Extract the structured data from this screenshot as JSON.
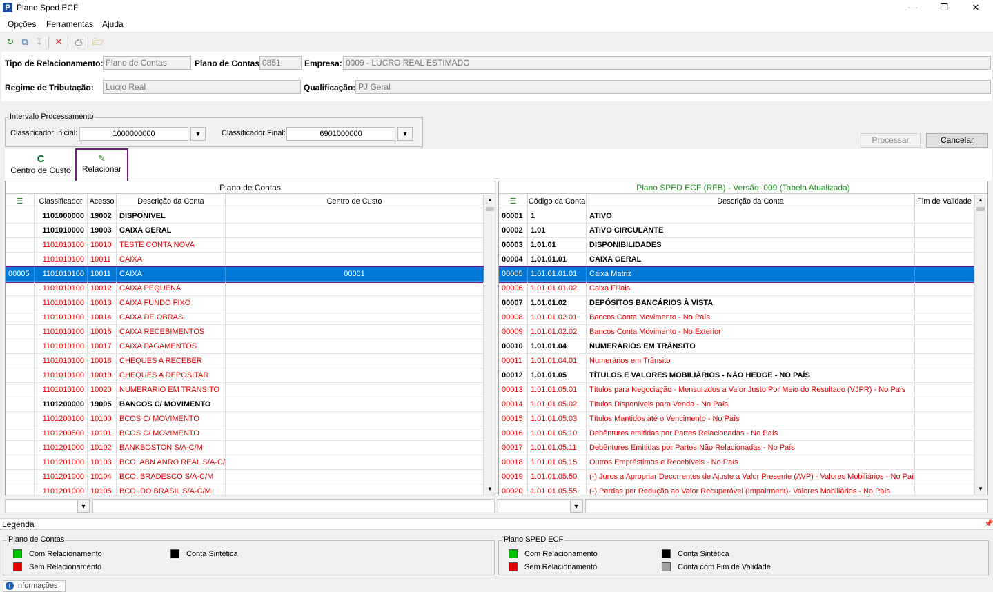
{
  "window": {
    "title": "Plano Sped ECF",
    "app_icon": "P"
  },
  "menu": [
    "Opções",
    "Ferramentas",
    "Ajuda"
  ],
  "form": {
    "tipo_label": "Tipo de Relacionamento:",
    "tipo_value": "Plano de Contas",
    "plano_label": "Plano de Contas:",
    "plano_value": "0851",
    "empresa_label": "Empresa:",
    "empresa_value": "0009 - LUCRO REAL ESTIMADO",
    "regime_label": "Regime de Tributação:",
    "regime_value": "Lucro Real",
    "qualificacao_label": "Qualificação:",
    "qualificacao_value": "PJ Geral"
  },
  "intervalo": {
    "title": "Intervalo Processamento",
    "inicial_label": "Classificador Inicial:",
    "inicial_value": "1000000000",
    "final_label": "Classificador Final:",
    "final_value": "6901000000"
  },
  "buttons": {
    "processar": "Processar",
    "cancelar": "Cancelar",
    "centro_glyph": "C",
    "centro": "Centro de Custo",
    "relacionar": "Relacionar"
  },
  "left_grid": {
    "title": "Plano de Contas",
    "headers": [
      "",
      "Classificador",
      "Acesso",
      "Descrição da Conta",
      "Centro de Custo"
    ],
    "rows": [
      {
        "n": "",
        "cls": "1101000000",
        "ac": "19002",
        "desc": "DISPONIVEL",
        "cc": "",
        "type": "sint"
      },
      {
        "n": "",
        "cls": "1101010000",
        "ac": "19003",
        "desc": "CAIXA GERAL",
        "cc": "",
        "type": "sint"
      },
      {
        "n": "",
        "cls": "1101010100",
        "ac": "10010",
        "desc": "TESTE CONTA NOVA",
        "cc": "",
        "type": "norel"
      },
      {
        "n": "",
        "cls": "1101010100",
        "ac": "10011",
        "desc": "CAIXA",
        "cc": "",
        "type": "norel"
      },
      {
        "n": "00005",
        "cls": "1101010100",
        "ac": "10011",
        "desc": "CAIXA",
        "cc": "00001",
        "type": "sel"
      },
      {
        "n": "",
        "cls": "1101010100",
        "ac": "10012",
        "desc": "CAIXA PEQUENA",
        "cc": "",
        "type": "norel"
      },
      {
        "n": "",
        "cls": "1101010100",
        "ac": "10013",
        "desc": "CAIXA FUNDO FIXO",
        "cc": "",
        "type": "norel"
      },
      {
        "n": "",
        "cls": "1101010100",
        "ac": "10014",
        "desc": "CAIXA DE OBRAS",
        "cc": "",
        "type": "norel"
      },
      {
        "n": "",
        "cls": "1101010100",
        "ac": "10016",
        "desc": "CAIXA RECEBIMENTOS",
        "cc": "",
        "type": "norel"
      },
      {
        "n": "",
        "cls": "1101010100",
        "ac": "10017",
        "desc": "CAIXA PAGAMENTOS",
        "cc": "",
        "type": "norel"
      },
      {
        "n": "",
        "cls": "1101010100",
        "ac": "10018",
        "desc": "CHEQUES A RECEBER",
        "cc": "",
        "type": "norel"
      },
      {
        "n": "",
        "cls": "1101010100",
        "ac": "10019",
        "desc": "CHEQUES A DEPOSITAR",
        "cc": "",
        "type": "norel"
      },
      {
        "n": "",
        "cls": "1101010100",
        "ac": "10020",
        "desc": "NUMERARIO EM TRANSITO",
        "cc": "",
        "type": "norel"
      },
      {
        "n": "",
        "cls": "1101200000",
        "ac": "19005",
        "desc": "BANCOS C/ MOVIMENTO",
        "cc": "",
        "type": "sint"
      },
      {
        "n": "",
        "cls": "1101200100",
        "ac": "10100",
        "desc": "BCOS C/ MOVIMENTO",
        "cc": "",
        "type": "norel"
      },
      {
        "n": "",
        "cls": "1101200500",
        "ac": "10101",
        "desc": "BCOS C/ MOVIMENTO",
        "cc": "",
        "type": "norel"
      },
      {
        "n": "",
        "cls": "1101201000",
        "ac": "10102",
        "desc": "BANKBOSTON S/A-C/M",
        "cc": "",
        "type": "norel"
      },
      {
        "n": "",
        "cls": "1101201000",
        "ac": "10103",
        "desc": "BCO. ABN ANRO REAL S/A-C/M",
        "cc": "",
        "type": "norel"
      },
      {
        "n": "",
        "cls": "1101201000",
        "ac": "10104",
        "desc": "BCO. BRADESCO S/A-C/M",
        "cc": "",
        "type": "norel"
      },
      {
        "n": "",
        "cls": "1101201000",
        "ac": "10105",
        "desc": "BCO. DO BRASIL S/A-C/M",
        "cc": "",
        "type": "norel"
      }
    ]
  },
  "right_grid": {
    "title": "Plano SPED ECF (RFB) - Versão: 009 (Tabela Atualizada)",
    "title_color": "#109010",
    "headers": [
      "",
      "Código da Conta",
      "Descrição da Conta",
      "Fim de Validade"
    ],
    "rows": [
      {
        "n": "00001",
        "code": "1",
        "desc": "ATIVO",
        "fim": "",
        "type": "sint"
      },
      {
        "n": "00002",
        "code": "1.01",
        "desc": "ATIVO CIRCULANTE",
        "fim": "",
        "type": "sint"
      },
      {
        "n": "00003",
        "code": "1.01.01",
        "desc": "DISPONIBILIDADES",
        "fim": "",
        "type": "sint"
      },
      {
        "n": "00004",
        "code": "1.01.01.01",
        "desc": "CAIXA GERAL",
        "fim": "",
        "type": "sint"
      },
      {
        "n": "00005",
        "code": "1.01.01.01.01",
        "desc": "Caixa Matriz",
        "fim": "",
        "type": "sel"
      },
      {
        "n": "00006",
        "code": "1.01.01.01.02",
        "desc": "Caixa Filiais",
        "fim": "",
        "type": "norel"
      },
      {
        "n": "00007",
        "code": "1.01.01.02",
        "desc": "DEPÓSITOS BANCÁRIOS À VISTA",
        "fim": "",
        "type": "sint"
      },
      {
        "n": "00008",
        "code": "1.01.01.02.01",
        "desc": "Bancos Conta Movimento - No País",
        "fim": "",
        "type": "norel"
      },
      {
        "n": "00009",
        "code": "1.01.01.02.02",
        "desc": "Bancos Conta Movimento - No Exterior",
        "fim": "",
        "type": "norel"
      },
      {
        "n": "00010",
        "code": "1.01.01.04",
        "desc": "NUMERÁRIOS EM TRÂNSITO",
        "fim": "",
        "type": "sint"
      },
      {
        "n": "00011",
        "code": "1.01.01.04.01",
        "desc": "Numerários em Trânsito",
        "fim": "",
        "type": "norel"
      },
      {
        "n": "00012",
        "code": "1.01.01.05",
        "desc": "TÍTULOS E VALORES MOBILIÁRIOS - NÃO HEDGE - NO PAÍS",
        "fim": "",
        "type": "sint"
      },
      {
        "n": "00013",
        "code": "1.01.01.05.01",
        "desc": "Títulos para Negociação - Mensurados a Valor Justo Por Meio do Resultado (VJPR) - No País",
        "fim": "",
        "type": "norel"
      },
      {
        "n": "00014",
        "code": "1.01.01.05.02",
        "desc": "Títulos Disponíveis para Venda - No País",
        "fim": "",
        "type": "norel"
      },
      {
        "n": "00015",
        "code": "1.01.01.05.03",
        "desc": "Títulos Mantidos até o Vencimento - No País",
        "fim": "",
        "type": "norel"
      },
      {
        "n": "00016",
        "code": "1.01.01.05.10",
        "desc": "Debêntures emitidas por Partes Relacionadas - No País",
        "fim": "",
        "type": "norel"
      },
      {
        "n": "00017",
        "code": "1.01.01.05.11",
        "desc": "Debêntures Emitidas por Partes Não Relacionadas - No País",
        "fim": "",
        "type": "norel"
      },
      {
        "n": "00018",
        "code": "1.01.01.05.15",
        "desc": "Outros Empréstimos e Recebíveis - No País",
        "fim": "",
        "type": "norel"
      },
      {
        "n": "00019",
        "code": "1.01.01.05.50",
        "desc": "(-) Juros a Apropriar Decorrentes de Ajuste a Valor Presente (AVP) -  Valores Mobiliários - No País",
        "fim": "",
        "type": "norel"
      },
      {
        "n": "00020",
        "code": "1.01.01.05.55",
        "desc": "(-) Perdas por Redução ao Valor Recuperável (Impairment)- Valores Mobiliários - No País",
        "fim": "",
        "type": "norel"
      }
    ]
  },
  "legend": {
    "title": "Legenda",
    "pin_icon": "pin-icon",
    "left": {
      "title": "Plano de Contas",
      "items": [
        {
          "label": "Com Relacionamento",
          "color": "#00c000"
        },
        {
          "label": "Sem Relacionamento",
          "color": "#e00000"
        },
        {
          "label": "Conta Sintética",
          "color": "#000000"
        }
      ]
    },
    "right": {
      "title": "Plano SPED ECF",
      "items": [
        {
          "label": "Com Relacionamento",
          "color": "#00c000"
        },
        {
          "label": "Sem Relacionamento",
          "color": "#e00000"
        },
        {
          "label": "Conta Sintética",
          "color": "#000000"
        },
        {
          "label": "Conta com Fim de Validade",
          "color": "#a0a0a0"
        }
      ]
    }
  },
  "status": {
    "info_tab": "Informações"
  },
  "colors": {
    "selection": "#0078d7",
    "highlight_border": "#7a1b82",
    "sem_relacionamento": "#e00000"
  }
}
